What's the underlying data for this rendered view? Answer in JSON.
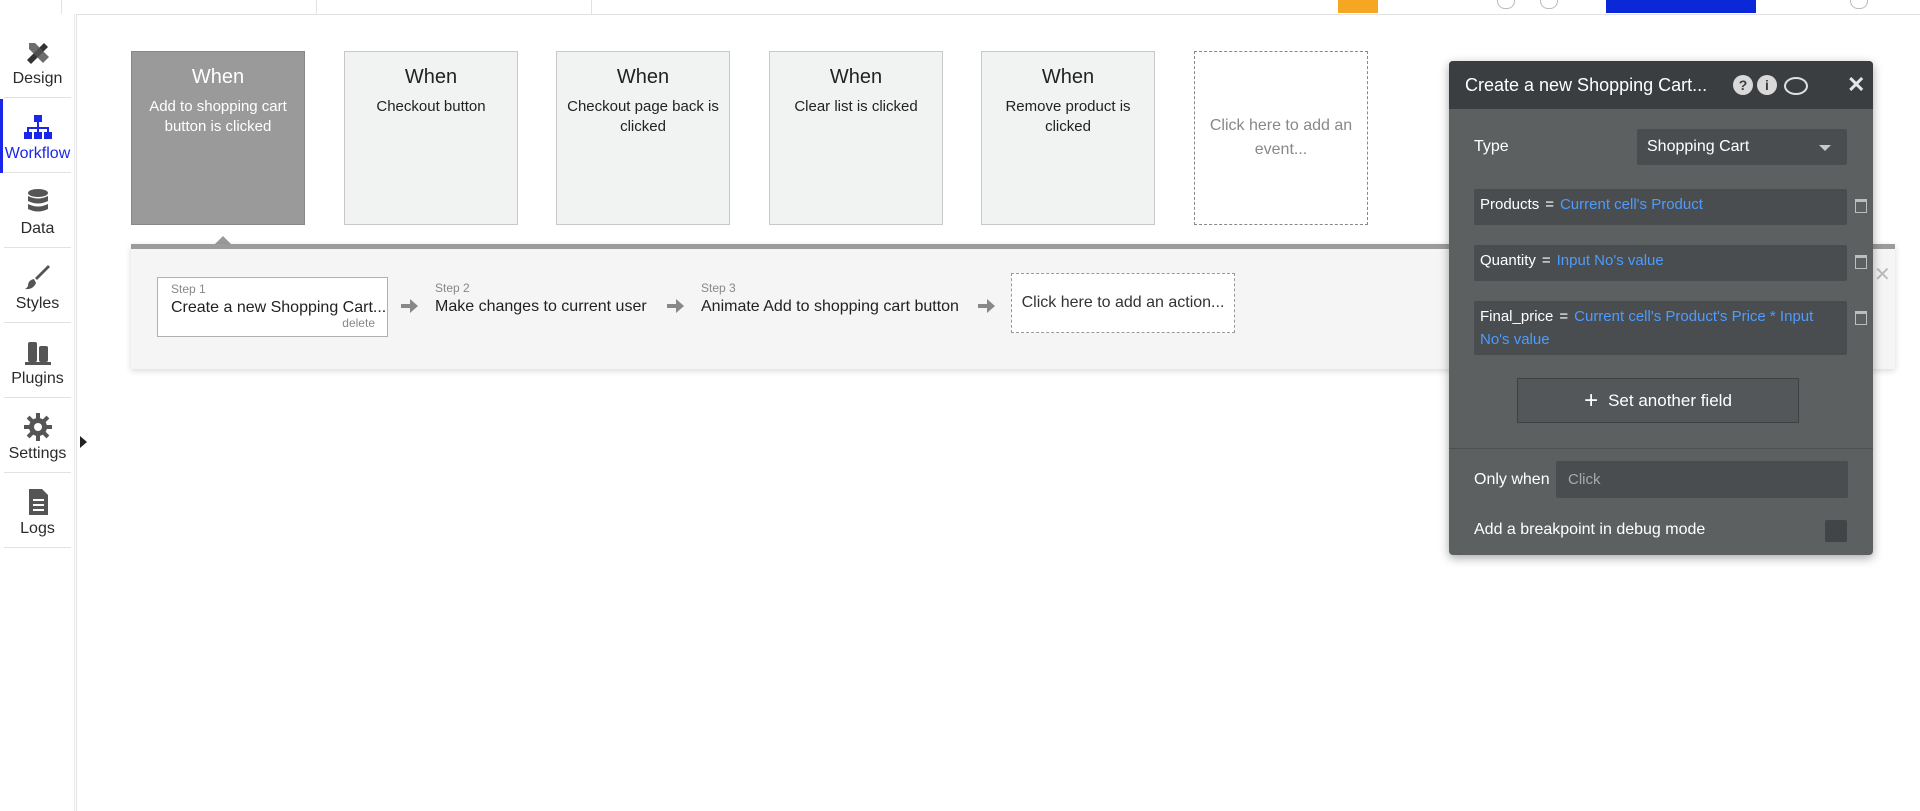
{
  "sidebar": {
    "items": [
      {
        "label": "Design",
        "icon": "design-icon"
      },
      {
        "label": "Workflow",
        "icon": "workflow-icon",
        "active": true
      },
      {
        "label": "Data",
        "icon": "database-icon"
      },
      {
        "label": "Styles",
        "icon": "brush-icon"
      },
      {
        "label": "Plugins",
        "icon": "plug-icon"
      },
      {
        "label": "Settings",
        "icon": "gear-icon"
      },
      {
        "label": "Logs",
        "icon": "document-icon"
      }
    ]
  },
  "events": [
    {
      "when": "When",
      "desc": "Add to shopping cart button is clicked",
      "selected": true
    },
    {
      "when": "When",
      "desc": "Checkout button"
    },
    {
      "when": "When",
      "desc": "Checkout page back is clicked"
    },
    {
      "when": "When",
      "desc": "Clear list is clicked"
    },
    {
      "when": "When",
      "desc": "Remove product is clicked"
    }
  ],
  "add_event_label": "Click here to add an event...",
  "steps": [
    {
      "num": "Step 1",
      "title": "Create a new Shopping Cart...",
      "delete": "delete"
    },
    {
      "num": "Step 2",
      "title": "Make changes to current user"
    },
    {
      "num": "Step 3",
      "title": "Animate Add to shopping cart button"
    }
  ],
  "add_action_label": "Click here to add an action...",
  "panel": {
    "title": "Create a new Shopping Cart...",
    "type_label": "Type",
    "type_value": "Shopping Cart",
    "fields": [
      {
        "name": "Products",
        "eq": "=",
        "expr": "Current cell's Product"
      },
      {
        "name": "Quantity",
        "eq": "=",
        "expr": "Input No's value"
      },
      {
        "name": "Final_price",
        "eq": "=",
        "expr": "Current cell's Product's Price * Input No's value"
      }
    ],
    "set_another_label": "Set another field",
    "only_when_label": "Only when",
    "only_when_placeholder": "Click",
    "breakpoint_label": "Add a breakpoint in debug mode"
  },
  "colors": {
    "accent": "#1a27e8",
    "panel_bg": "#5d6061",
    "panel_header": "#3b3e40",
    "expression": "#4c9bff",
    "selected_event": "#9a9a9a"
  }
}
